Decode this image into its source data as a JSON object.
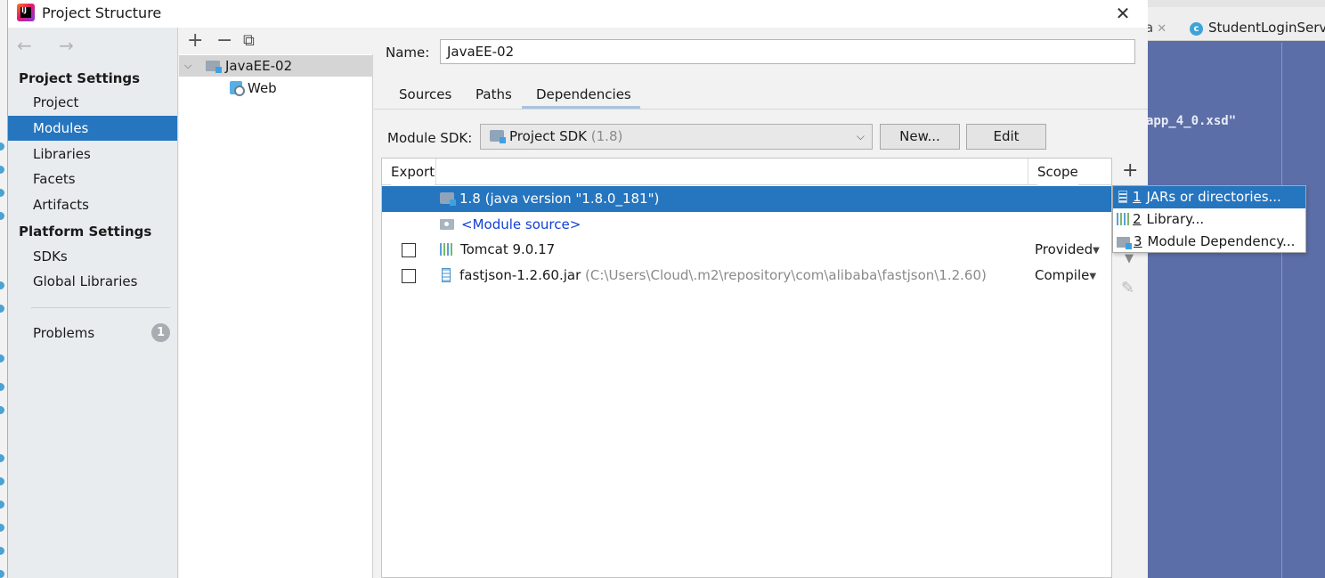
{
  "window": {
    "title": "Project Structure",
    "close_glyph": "✕"
  },
  "ide": {
    "tab_partial": "a",
    "tab_file": "StudentLoginServ",
    "tab_icon_letter": "c",
    "code_fragment": "app_4_0.xsd\""
  },
  "nav": {
    "arrows": "← →",
    "project_settings_header": "Project Settings",
    "project_settings_items": [
      "Project",
      "Modules",
      "Libraries",
      "Facets",
      "Artifacts"
    ],
    "selected": "Modules",
    "platform_settings_header": "Platform Settings",
    "platform_settings_items": [
      "SDKs",
      "Global Libraries"
    ],
    "problems_label": "Problems",
    "problems_count": "1"
  },
  "tree": {
    "toolbar": {
      "add": "+",
      "remove": "−",
      "copy": "⧉"
    },
    "module": "JavaEE-02",
    "facet": "Web"
  },
  "module": {
    "name_label": "Name:",
    "name_value": "JavaEE-02",
    "tabs": [
      "Sources",
      "Paths",
      "Dependencies"
    ],
    "active_tab": "Dependencies",
    "sdk_label": "Module SDK:",
    "sdk_value": "Project SDK",
    "sdk_version": "(1.8)",
    "new_button": "New...",
    "edit_button": "Edit"
  },
  "dependencies": {
    "headers": {
      "export": "Export",
      "scope": "Scope"
    },
    "rows": [
      {
        "name": "1.8 (java version \"1.8.0_181\")",
        "selected": true
      },
      {
        "name": "<Module source>"
      },
      {
        "name": "Tomcat 9.0.17",
        "scope": "Provided",
        "export_checked": false
      },
      {
        "name": "fastjson-1.2.60.jar",
        "path": "(C:\\Users\\Cloud\\.m2\\repository\\com\\alibaba\\fastjson\\1.2.60)",
        "scope": "Compile",
        "export_checked": false
      }
    ],
    "side_add": "+",
    "side_down": "▼",
    "side_edit": "✎"
  },
  "add_menu": {
    "items": [
      {
        "num": "1",
        "label": "JARs or directories..."
      },
      {
        "num": "2",
        "label": "Library..."
      },
      {
        "num": "3",
        "label": "Module Dependency..."
      }
    ],
    "selected_index": 0
  },
  "colors": {
    "selection": "#2675bf",
    "link": "#1140d6",
    "ide_background": "#5c6ea7"
  }
}
